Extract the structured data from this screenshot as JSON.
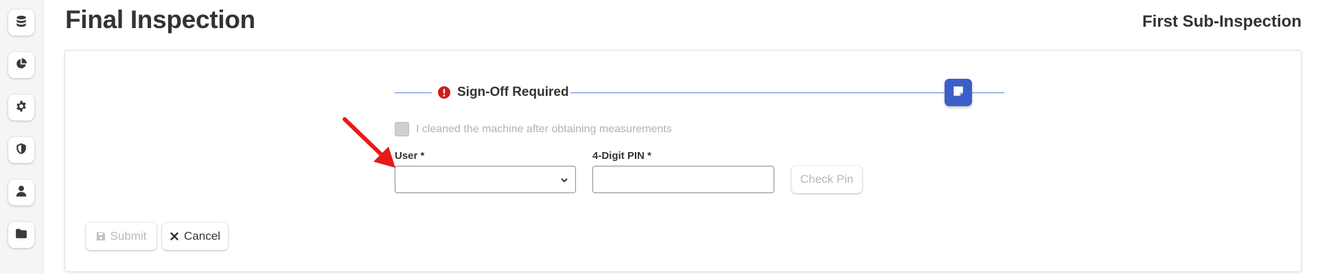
{
  "sidebar": {
    "items": [
      {
        "icon": "database-icon"
      },
      {
        "icon": "chart-pie-icon"
      },
      {
        "icon": "gear-icon"
      },
      {
        "icon": "shield-icon"
      },
      {
        "icon": "user-icon"
      },
      {
        "icon": "folder-icon"
      }
    ]
  },
  "header": {
    "title": "Final Inspection",
    "subtitle": "First Sub-Inspection"
  },
  "section": {
    "title": "Sign-Off Required",
    "alert_icon": "exclamation-circle-icon",
    "note_icon": "sticky-note-icon",
    "accent_color": "#3b5fc9",
    "alert_color": "#cc1f1f"
  },
  "form": {
    "checkbox_label": "I cleaned the machine after obtaining measurements",
    "checkbox_checked": false,
    "user_label": "User *",
    "user_value": "",
    "pin_label": "4-Digit PIN *",
    "pin_value": "",
    "check_pin_label": "Check Pin"
  },
  "actions": {
    "submit_label": "Submit",
    "cancel_label": "Cancel"
  },
  "annotation": {
    "type": "arrow",
    "color": "#e8191a"
  }
}
